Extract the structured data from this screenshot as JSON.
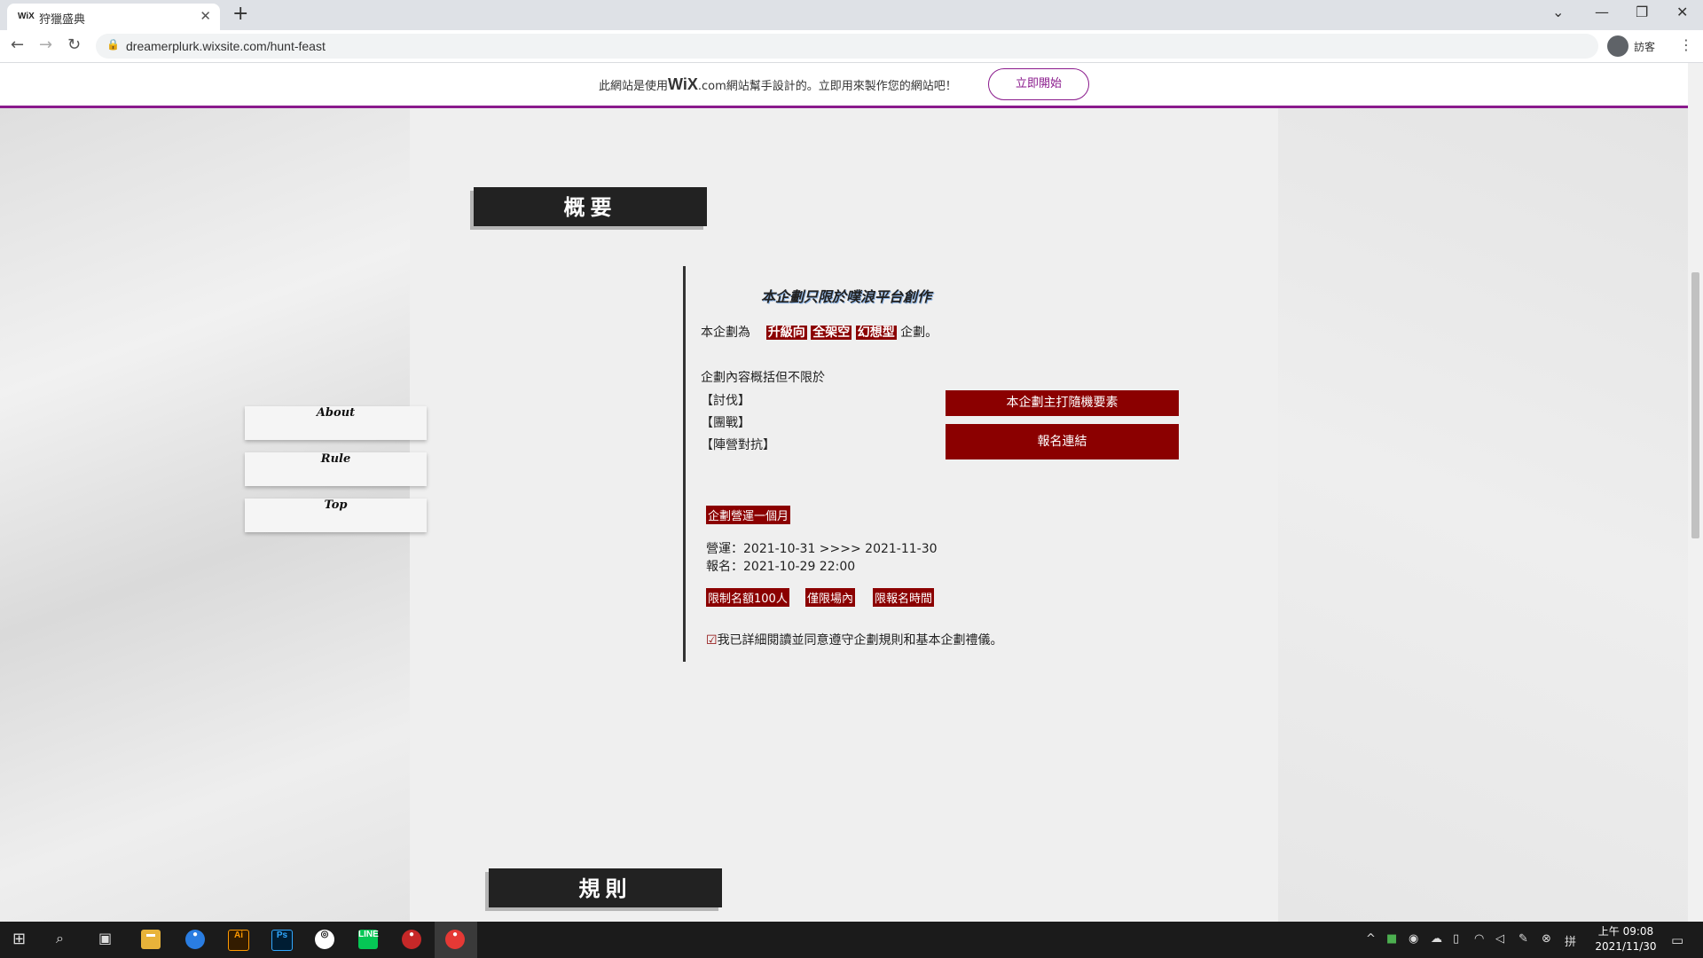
{
  "browser": {
    "tab_favicon": "WiX",
    "tab_title": "狩獵盛典",
    "url": "dreamerplurk.wixsite.com/hunt-feast",
    "profile_name": "訪客"
  },
  "wix_banner": {
    "text_prefix": "此網站是使用",
    "brand": "WiX",
    "brand_suffix": ".com",
    "text_suffix": "網站幫手設計的。立即用來製作您的網站吧！",
    "start_button": "立即開始",
    "accent_color": "#8a1a8c"
  },
  "page": {
    "overview_heading": "概要",
    "rules_heading": "規則",
    "side_nav": [
      "About",
      "Rule",
      "Top"
    ],
    "notice": "本企劃只限於噗浪平台創作",
    "intro_prefix": "本企劃為",
    "intro_tags": [
      "升級向",
      "全架空",
      "幻想型"
    ],
    "intro_suffix": "企劃。",
    "content_heading": "企劃內容概括但不限於",
    "content_items": [
      "【討伐】",
      "【團戰】",
      "【陣營對抗】"
    ],
    "button_random": "本企劃主打隨機要素",
    "button_signup": "報名連結",
    "duration_tag": "企劃營運一個月",
    "operation": "營運：2021-10-31 >>>> 2021-11-30",
    "registration": "報名：2021-10-29 22:00",
    "limit_tags": [
      "限制名額100人",
      "僅限場內",
      "限報名時間"
    ],
    "agreement": "我已詳細閱讀並同意遵守企劃規則和基本企劃禮儀。",
    "accent_color": "#8b0000"
  },
  "taskbar": {
    "time": "上午 09:08",
    "date": "2021/11/30"
  }
}
